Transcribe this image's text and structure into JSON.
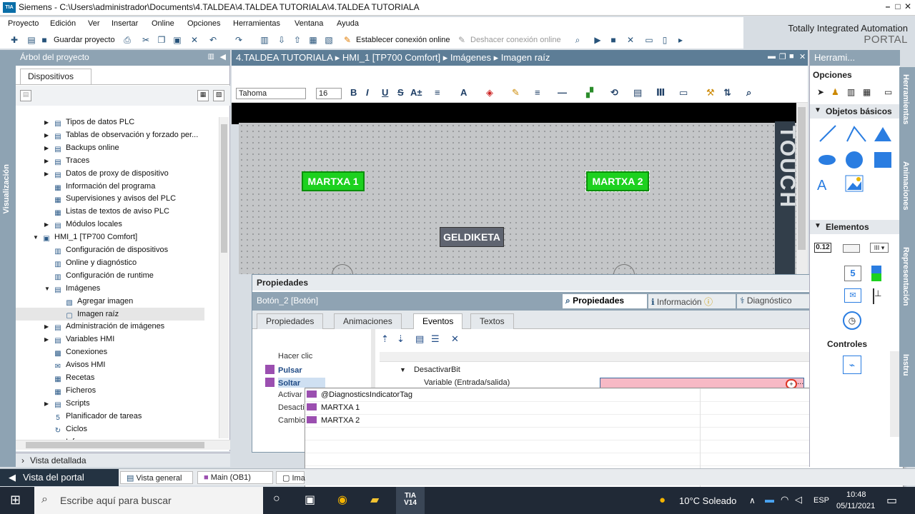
{
  "window": {
    "title": "Siemens - C:\\Users\\administrador\\Documents\\4.TALDEA\\4.TALDEA TUTORIALA\\4.TALDEA TUTORIALA",
    "logo": "TIA",
    "min": "–",
    "restore": "□",
    "close": "✕"
  },
  "menu": [
    "Proyecto",
    "Edición",
    "Ver",
    "Insertar",
    "Online",
    "Opciones",
    "Herramientas",
    "Ventana",
    "Ayuda"
  ],
  "toolbar": {
    "save": "Guardar proyecto",
    "connect": "Establecer conexión online",
    "disconnect": "Deshacer conexión online"
  },
  "brand": {
    "line1": "Totally Integrated Automation",
    "line2": "PORTAL"
  },
  "left_strip": "Visualización",
  "tree": {
    "header": "Árbol del proyecto",
    "tab": "Dispositivos",
    "items": [
      {
        "label": "Tipos de datos PLC",
        "arrow": "▶",
        "icon": "▤",
        "level": 2
      },
      {
        "label": "Tablas de observación y forzado per...",
        "arrow": "▶",
        "icon": "▤",
        "level": 2
      },
      {
        "label": "Backups online",
        "arrow": "▶",
        "icon": "▤",
        "level": 2
      },
      {
        "label": "Traces",
        "arrow": "▶",
        "icon": "▤",
        "level": 2
      },
      {
        "label": "Datos de proxy de dispositivo",
        "arrow": "▶",
        "icon": "▤",
        "level": 2
      },
      {
        "label": "Información del programa",
        "arrow": "",
        "icon": "▦",
        "level": 2
      },
      {
        "label": "Supervisiones y avisos del PLC",
        "arrow": "",
        "icon": "▦",
        "level": 2
      },
      {
        "label": "Listas de textos de aviso PLC",
        "arrow": "",
        "icon": "▦",
        "level": 2
      },
      {
        "label": "Módulos locales",
        "arrow": "▶",
        "icon": "▤",
        "level": 2
      },
      {
        "label": "HMI_1 [TP700 Comfort]",
        "arrow": "▼",
        "icon": "▣",
        "level": 1
      },
      {
        "label": "Configuración de dispositivos",
        "arrow": "",
        "icon": "▥",
        "level": 2
      },
      {
        "label": "Online y diagnóstico",
        "arrow": "",
        "icon": "▥",
        "level": 2
      },
      {
        "label": "Configuración de runtime",
        "arrow": "",
        "icon": "▥",
        "level": 2
      },
      {
        "label": "Imágenes",
        "arrow": "▼",
        "icon": "▤",
        "level": 2
      },
      {
        "label": "Agregar imagen",
        "arrow": "",
        "icon": "▧",
        "level": 3
      },
      {
        "label": "Imagen raíz",
        "arrow": "",
        "icon": "▢",
        "level": 3
      },
      {
        "label": "Administración de imágenes",
        "arrow": "▶",
        "icon": "▤",
        "level": 2
      },
      {
        "label": "Variables HMI",
        "arrow": "▶",
        "icon": "▤",
        "level": 2
      },
      {
        "label": "Conexiones",
        "arrow": "",
        "icon": "▩",
        "level": 2
      },
      {
        "label": "Avisos HMI",
        "arrow": "",
        "icon": "✉",
        "level": 2
      },
      {
        "label": "Recetas",
        "arrow": "",
        "icon": "▦",
        "level": 2
      },
      {
        "label": "Ficheros",
        "arrow": "",
        "icon": "▦",
        "level": 2
      },
      {
        "label": "Scripts",
        "arrow": "▶",
        "icon": "▤",
        "level": 2
      },
      {
        "label": "Planificador de tareas",
        "arrow": "",
        "icon": "5",
        "level": 2
      },
      {
        "label": "Ciclos",
        "arrow": "",
        "icon": "↻",
        "level": 2
      },
      {
        "label": "Informes",
        "arrow": "▶",
        "icon": "▤",
        "level": 2
      }
    ],
    "selected": "Imagen raíz",
    "detailed_view": "Vista detallada"
  },
  "editor": {
    "breadcrumb": "4.TALDEA TUTORIALA  ▸  HMI_1 [TP700 Comfort]  ▸  Imágenes  ▸  Imagen raíz",
    "font": "Tahoma",
    "font_size": "16",
    "buttons": {
      "martxa1": "MARTXA 1",
      "martxa2": "MARTXA 2",
      "geldiketa": "GELDIKETA"
    },
    "side_text": "TOUCH"
  },
  "properties": {
    "title": "Propiedades",
    "object": "Botón_2 [Botón]",
    "right_tabs": [
      "Propiedades",
      "Información",
      "Diagnóstico"
    ],
    "subtabs": [
      "Propiedades",
      "Animaciones",
      "Eventos",
      "Textos"
    ],
    "active_subtab": "Eventos",
    "events": [
      "Hacer clic",
      "Pulsar",
      "Soltar",
      "Activar",
      "Desacti",
      "Cambio"
    ],
    "function": "DesactivarBit",
    "param_label": "Variable (Entrada/salida)"
  },
  "dropdown": {
    "options": [
      "@DiagnosticsIndicatorTag",
      "MARTXA 1",
      "MARTXA 2"
    ]
  },
  "tools": {
    "header": "Herrami...",
    "options": "Opciones",
    "basic_objects": "Objetos básicos",
    "elements": "Elementos",
    "controls": "Controles",
    "elements_io": "0.12",
    "elements_numbox": "5",
    "side_tabs": [
      "Herramientas",
      "Animaciones",
      "Representación",
      "Instru"
    ]
  },
  "portal": {
    "view": "Vista del portal",
    "tasks": [
      "Vista general",
      "Main (OB1)",
      "Ima"
    ]
  },
  "taskbar": {
    "search": "Escribe aquí para buscar",
    "weather": "10°C  Soleado",
    "lang": "ESP",
    "time": "10:48",
    "date": "05/11/2021",
    "app": "TIA\nV14"
  }
}
